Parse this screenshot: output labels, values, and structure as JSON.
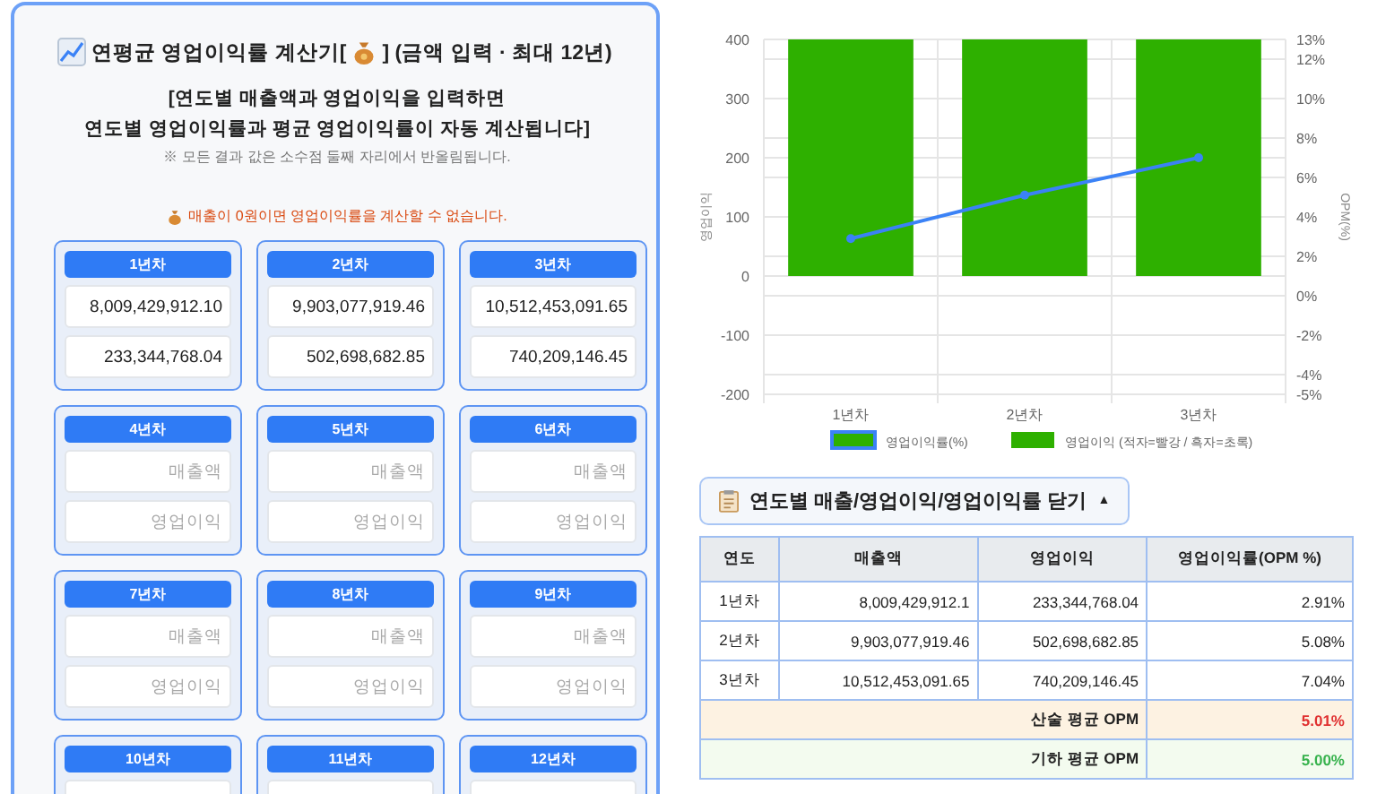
{
  "calculator": {
    "title_before": "연평균 영업이익률 계산기[",
    "title_after": "] (금액 입력 · 최대 12년)",
    "description_lines": [
      "[연도별 매출액과 영업이익을 입력하면",
      "연도별 영업이익률과 평균 영업이익률이 자동 계산됩니다]"
    ],
    "note": "※ 모든 결과 값은 소수점 둘째 자리에서 반올림됩니다.",
    "warning": "매출이 0원이면 영업이익률을 계산할 수 없습니다.",
    "years": [
      {
        "label": "1년차",
        "sales": {
          "value": "8,009,429,912.10"
        },
        "profit": {
          "value": "233,344,768.04"
        }
      },
      {
        "label": "2년차",
        "sales": {
          "value": "9,903,077,919.46"
        },
        "profit": {
          "value": "502,698,682.85"
        }
      },
      {
        "label": "3년차",
        "sales": {
          "value": "10,512,453,091.65"
        },
        "profit": {
          "value": "740,209,146.45"
        }
      },
      {
        "label": "4년차",
        "sales": {
          "placeholder": "매출액"
        },
        "profit": {
          "placeholder": "영업이익"
        }
      },
      {
        "label": "5년차",
        "sales": {
          "placeholder": "매출액"
        },
        "profit": {
          "placeholder": "영업이익"
        }
      },
      {
        "label": "6년차",
        "sales": {
          "placeholder": "매출액"
        },
        "profit": {
          "placeholder": "영업이익"
        }
      },
      {
        "label": "7년차",
        "sales": {
          "placeholder": "매출액"
        },
        "profit": {
          "placeholder": "영업이익"
        }
      },
      {
        "label": "8년차",
        "sales": {
          "placeholder": "매출액"
        },
        "profit": {
          "placeholder": "영업이익"
        }
      },
      {
        "label": "9년차",
        "sales": {
          "placeholder": "매출액"
        },
        "profit": {
          "placeholder": "영업이익"
        }
      },
      {
        "label": "10년차"
      },
      {
        "label": "11년차"
      },
      {
        "label": "12년차"
      }
    ]
  },
  "chart": {
    "chart_data": {
      "type": "bar",
      "grid": true,
      "legend": true,
      "ylabel": "영업이익",
      "y2label": "OPM(%)",
      "categories": [
        "1년차",
        "2년차",
        "3년차"
      ],
      "ylim": [
        -200,
        400
      ],
      "yticks": [
        -200,
        -100,
        0,
        100,
        200,
        300,
        400
      ],
      "y2lim": [
        -5,
        13
      ],
      "y2ticks": [
        {
          "value": -5,
          "label": "-5%"
        },
        {
          "value": -4,
          "label": "-4%"
        },
        {
          "value": -2,
          "label": "-2%"
        },
        {
          "value": 0,
          "label": "0%"
        },
        {
          "value": 2,
          "label": "2%"
        },
        {
          "value": 4,
          "label": "4%"
        },
        {
          "value": 6,
          "label": "6%"
        },
        {
          "value": 8,
          "label": "8%"
        },
        {
          "value": 10,
          "label": "10%"
        },
        {
          "value": 12,
          "label": "12%"
        },
        {
          "value": 13,
          "label": "13%"
        }
      ],
      "series": [
        {
          "name": "영업이익률(%)",
          "type": "line",
          "axis": "y2",
          "marker": true,
          "color": "#3b82f6",
          "values": [
            2.9,
            5.1,
            7.0
          ]
        },
        {
          "name": "영업이익 (적자=빨강 / 흑자=초록)",
          "color": "#2eb000",
          "values": [
            400,
            400,
            400
          ]
        }
      ]
    }
  },
  "table_toggle": {
    "label": "연도별 매출/영업이익/영업이익률 닫기",
    "caret": "▲"
  },
  "table": {
    "columns": [
      "연도",
      "매출액",
      "영업이익",
      "영업이익률(OPM %)"
    ],
    "rows": [
      [
        "1년차",
        "8,009,429,912.1",
        "233,344,768.04",
        "2.91%"
      ],
      [
        "2년차",
        "9,903,077,919.46",
        "502,698,682.85",
        "5.08%"
      ],
      [
        "3년차",
        "10,512,453,091.65",
        "740,209,146.45",
        "7.04%"
      ]
    ],
    "summary": [
      {
        "label": "산술 평균 OPM",
        "value": "5.01%",
        "kind": "arithmetic",
        "color": "#e03131"
      },
      {
        "label": "기하 평균 OPM",
        "value": "5.00%",
        "kind": "geometric",
        "color": "#37b24d"
      }
    ]
  }
}
